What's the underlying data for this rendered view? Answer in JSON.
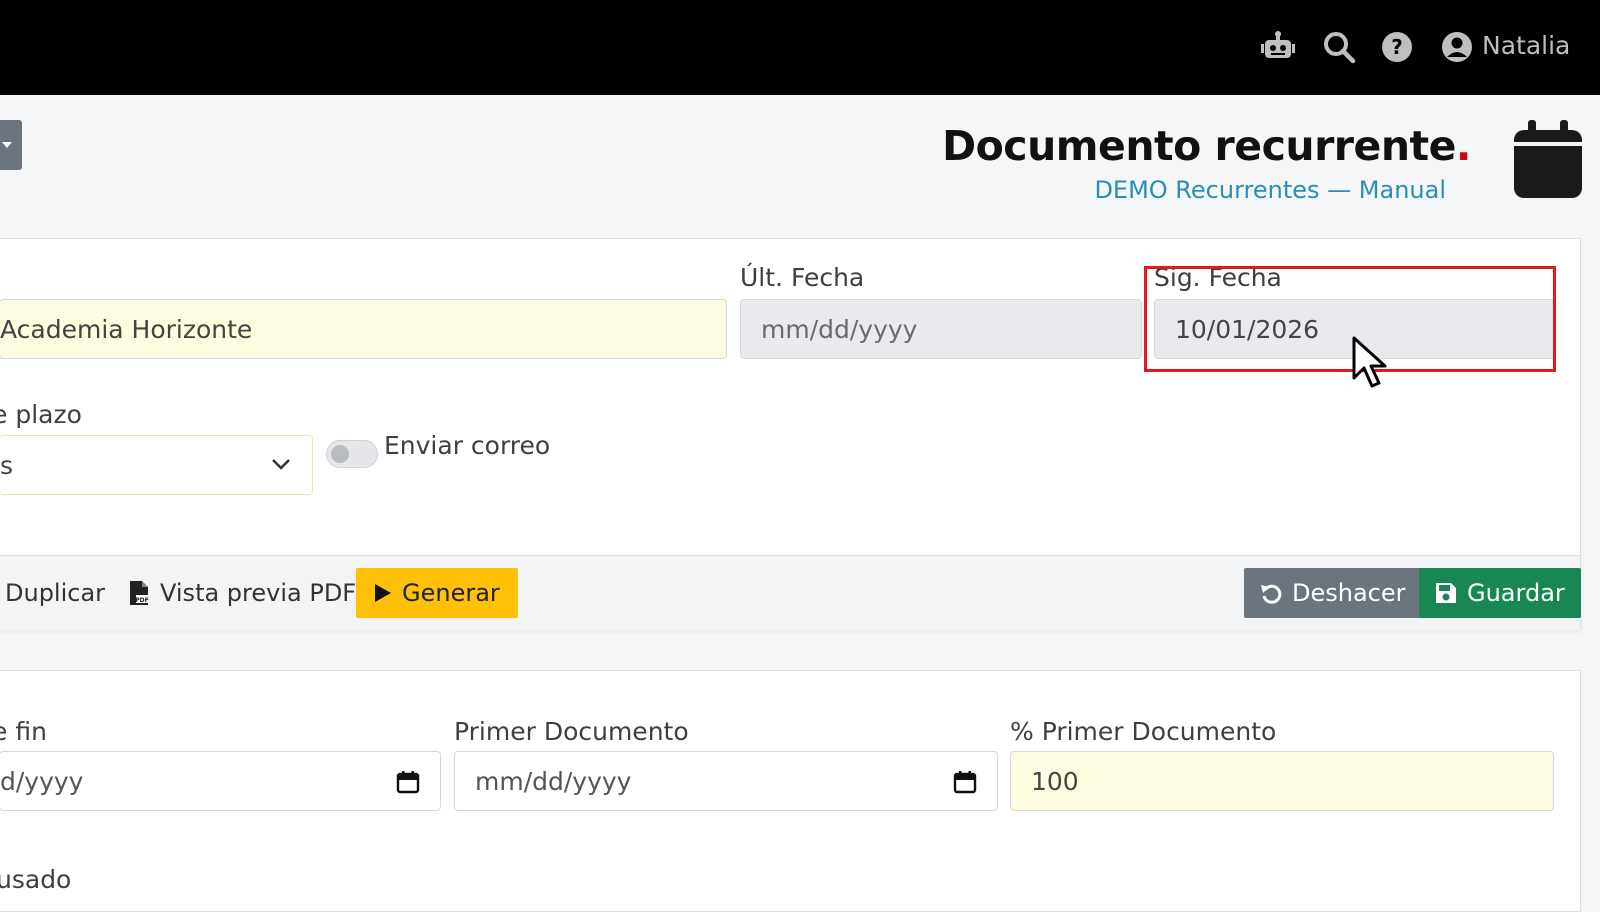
{
  "topbar": {
    "icons": [
      "robot-icon",
      "search-icon",
      "help-icon",
      "user-icon"
    ],
    "user_name": "Natalia"
  },
  "header": {
    "title": "Documento recurrente",
    "title_dot": ".",
    "subtitle": "DEMO Recurrentes — Manual",
    "icon": "calendar-icon"
  },
  "form": {
    "client_value": "Academia Horizonte",
    "ult_fecha": {
      "label": "Últ. Fecha",
      "placeholder": "mm/dd/yyyy"
    },
    "sig_fecha": {
      "label": "Sig. Fecha",
      "value": "10/01/2026"
    },
    "plazo": {
      "label_partial": "e plazo",
      "value_partial": "s"
    },
    "enviar_correo": {
      "label": "Enviar correo",
      "checked": false
    }
  },
  "actions": {
    "duplicar": "Duplicar",
    "vista_previa": "Vista previa PDF",
    "generar": "Generar",
    "deshacer": "Deshacer",
    "guardar": "Guardar"
  },
  "section2": {
    "fecha_fin": {
      "label_partial": "e fin",
      "value_partial": "d/yyyy"
    },
    "primer_documento": {
      "label": "Primer Documento",
      "placeholder": "mm/dd/yyyy"
    },
    "pct_primer_documento": {
      "label": "% Primer Documento",
      "value": "100"
    },
    "usado_label_partial": "usado"
  },
  "colors": {
    "topbar": "#000000",
    "accent_link": "#2a8fb5",
    "generar": "#ffc107",
    "deshacer": "#6c757d",
    "guardar": "#198754",
    "highlight": "#e4161e",
    "title_dot": "#d0021b"
  }
}
